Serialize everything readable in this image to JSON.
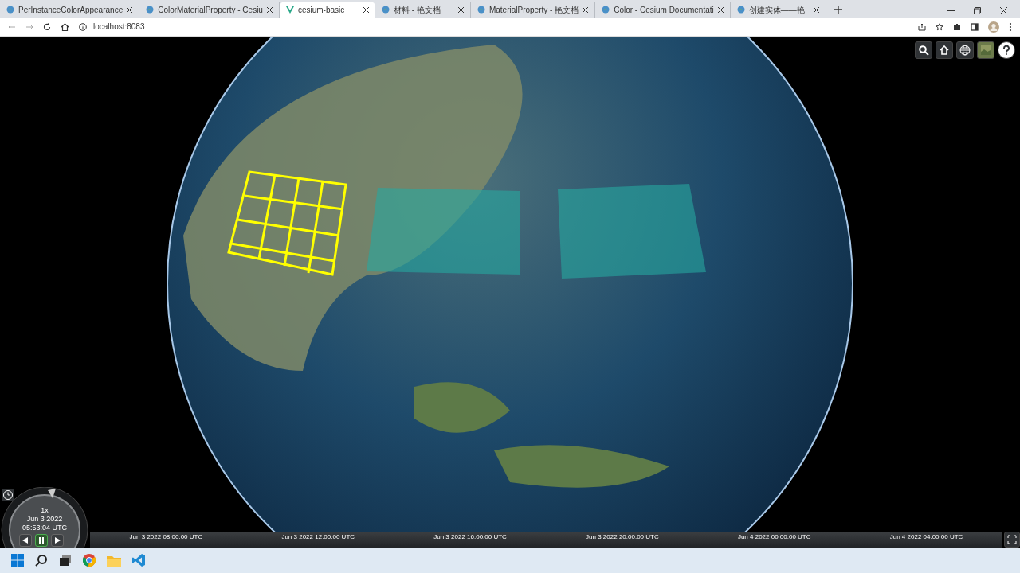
{
  "browser": {
    "tabs": [
      {
        "title": "PerInstanceColorAppearance",
        "selected": false,
        "kind": "globe"
      },
      {
        "title": "ColorMaterialProperty - Cesiu",
        "selected": false,
        "kind": "globe"
      },
      {
        "title": "cesium-basic",
        "selected": true,
        "kind": "vue"
      },
      {
        "title": "材料 - 艳文档",
        "selected": false,
        "kind": "globe"
      },
      {
        "title": "MaterialProperty - 艳文档",
        "selected": false,
        "kind": "globe"
      },
      {
        "title": "Color - Cesium Documentati",
        "selected": false,
        "kind": "globe"
      },
      {
        "title": "创建实体——艳",
        "selected": false,
        "kind": "globe"
      }
    ],
    "address": "localhost:8083"
  },
  "animation": {
    "speed": "1x",
    "date": "Jun 3 2022",
    "time": "05:53:04 UTC",
    "paused": true
  },
  "timeline": {
    "labels": [
      "Jun 3 2022 08:00:00 UTC",
      "Jun 3 2022 12:00:00 UTC",
      "Jun 3 2022 16:00:00 UTC",
      "Jun 3 2022 20:00:00 UTC",
      "Jun 4 2022 00:00:00 UTC",
      "Jun 4 2022 04:00:00 UTC"
    ]
  }
}
